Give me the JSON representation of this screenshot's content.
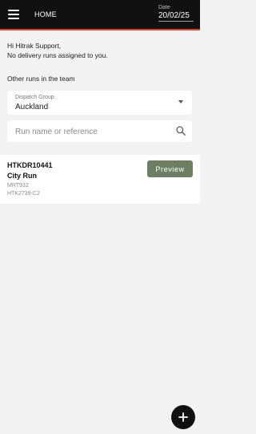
{
  "header": {
    "title": "HOME",
    "date_label": "Date",
    "date_value": "20/02/25",
    "menu_icon": "menu-icon"
  },
  "greeting": {
    "line1": "Hi Hitrak Support,",
    "line2": "No delivery runs assigned to you."
  },
  "team_section": {
    "label": "Other runs in the team"
  },
  "dispatch_group": {
    "caption": "Dispatch Group",
    "value": "Auckland"
  },
  "search": {
    "placeholder": "Run name or reference",
    "value": ""
  },
  "runs": [
    {
      "reference": "HTKDR10441",
      "name": "City Run",
      "code1": "MRT932",
      "code2": "HTK2739-C2",
      "action_label": "Preview"
    }
  ],
  "fab": {
    "icon": "plus-icon"
  },
  "colors": {
    "header_bg": "#111111",
    "header_accent": "#e0422b",
    "preview_button": "#6d7f62",
    "page_bg": "#f2f2f2"
  }
}
